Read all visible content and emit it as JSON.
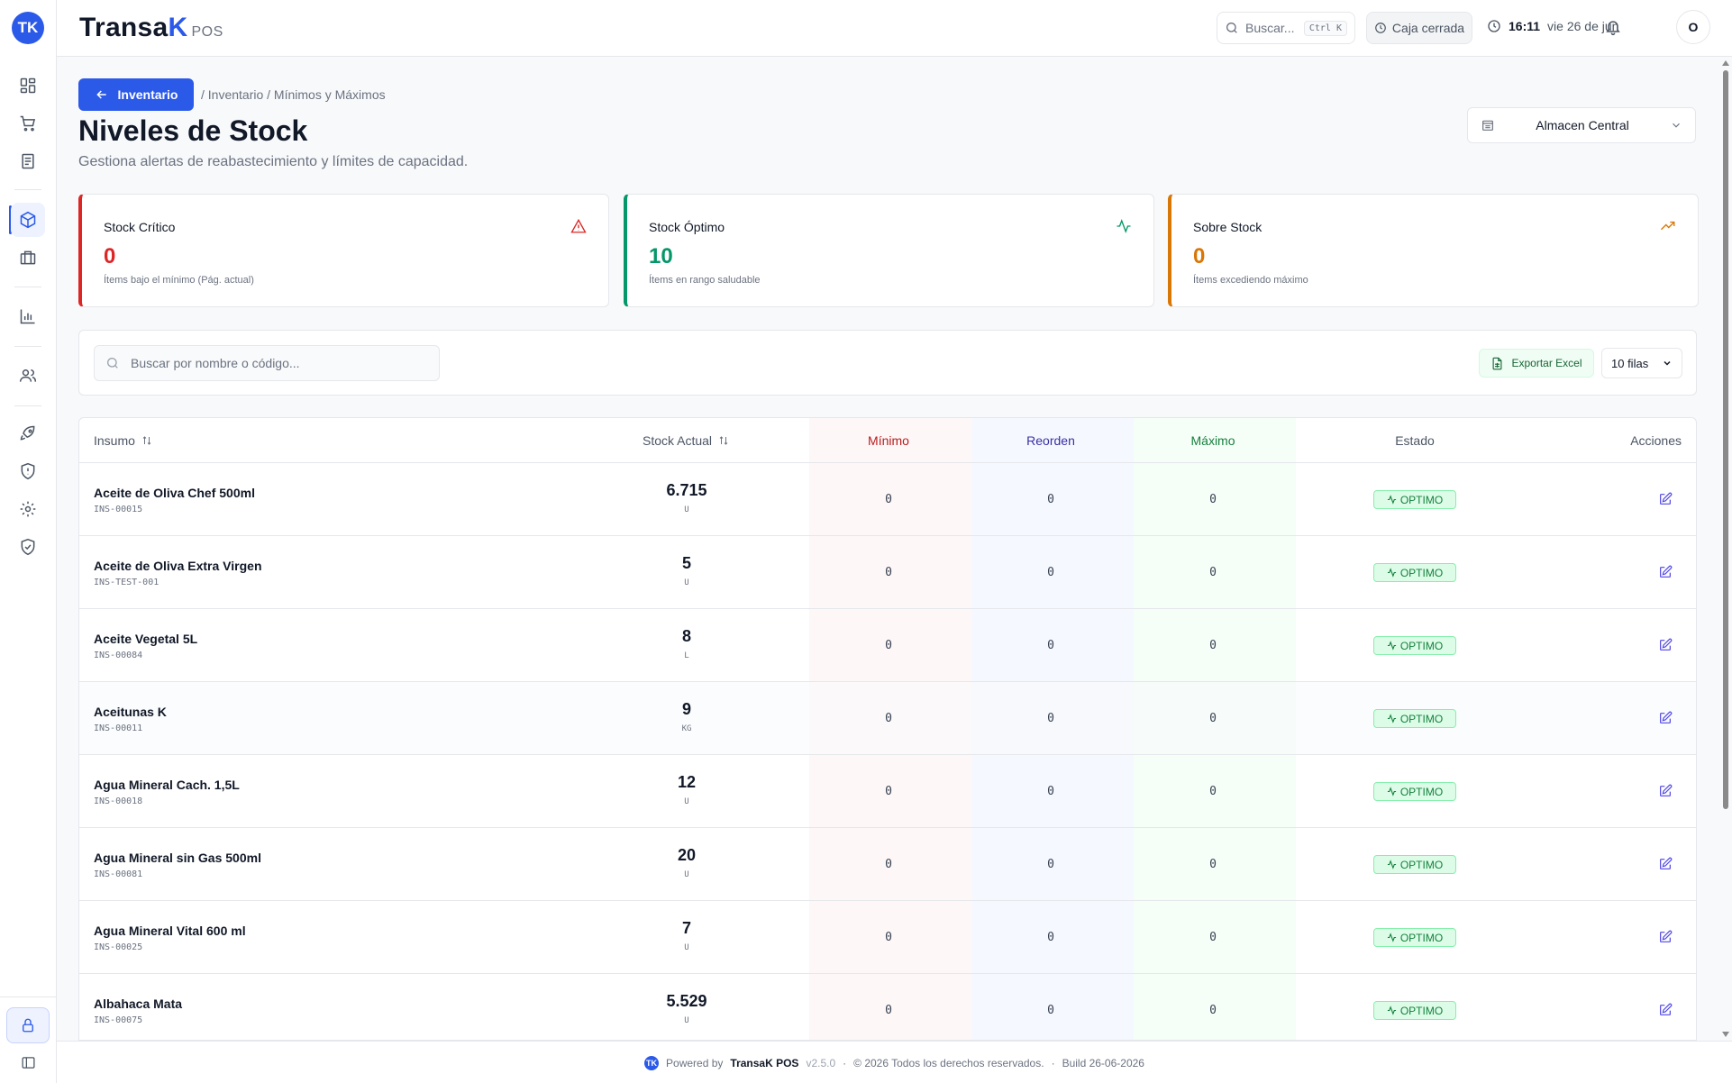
{
  "app": {
    "brand_main": "Transa",
    "brand_k": "K",
    "brand_pos": "POS",
    "logo_glyph": "TK"
  },
  "header": {
    "search_placeholder": "Buscar...",
    "search_shortcut": "Ctrl K",
    "cash_status": "Caja cerrada",
    "time": "16:11",
    "date": "vie 26 de jun",
    "avatar_initial": "O"
  },
  "page": {
    "back_label": "Inventario",
    "breadcrumb": "/ Inventario / Mínimos y Máximos",
    "title": "Niveles de Stock",
    "subtitle": "Gestiona alertas de reabastecimiento y límites de capacidad.",
    "warehouse": "Almacen Central"
  },
  "kpis": [
    {
      "label": "Stock Crítico",
      "value": "0",
      "desc": "Ítems bajo el mínimo (Pág. actual)",
      "color": "#dc2626",
      "icon": "warning-triangle-icon"
    },
    {
      "label": "Stock Óptimo",
      "value": "10",
      "desc": "Ítems en rango saludable",
      "color": "#059669",
      "icon": "activity-icon"
    },
    {
      "label": "Sobre Stock",
      "value": "0",
      "desc": "Ítems excediendo máximo",
      "color": "#d97706",
      "icon": "trending-up-icon"
    }
  ],
  "toolbar": {
    "search_placeholder": "Buscar por nombre o código...",
    "export_label": "Exportar Excel",
    "rows_label": "10 filas"
  },
  "table": {
    "columns": {
      "insumo": "Insumo",
      "stock": "Stock Actual",
      "minimo": "Mínimo",
      "reorden": "Reorden",
      "maximo": "Máximo",
      "estado": "Estado",
      "acciones": "Acciones"
    },
    "rows": [
      {
        "name": "Aceite de Oliva Chef 500ml",
        "code": "INS-00015",
        "stock": "6.715",
        "unit": "U",
        "min": "0",
        "reorder": "0",
        "max": "0",
        "status": "OPTIMO"
      },
      {
        "name": "Aceite de Oliva Extra Virgen",
        "code": "INS-TEST-001",
        "stock": "5",
        "unit": "U",
        "min": "0",
        "reorder": "0",
        "max": "0",
        "status": "OPTIMO"
      },
      {
        "name": "Aceite Vegetal 5L",
        "code": "INS-00084",
        "stock": "8",
        "unit": "L",
        "min": "0",
        "reorder": "0",
        "max": "0",
        "status": "OPTIMO"
      },
      {
        "name": "Aceitunas K",
        "code": "INS-00011",
        "stock": "9",
        "unit": "KG",
        "min": "0",
        "reorder": "0",
        "max": "0",
        "status": "OPTIMO"
      },
      {
        "name": "Agua Mineral Cach. 1,5L",
        "code": "INS-00018",
        "stock": "12",
        "unit": "U",
        "min": "0",
        "reorder": "0",
        "max": "0",
        "status": "OPTIMO"
      },
      {
        "name": "Agua Mineral sin Gas 500ml",
        "code": "INS-00081",
        "stock": "20",
        "unit": "U",
        "min": "0",
        "reorder": "0",
        "max": "0",
        "status": "OPTIMO"
      },
      {
        "name": "Agua Mineral Vital 600 ml",
        "code": "INS-00025",
        "stock": "7",
        "unit": "U",
        "min": "0",
        "reorder": "0",
        "max": "0",
        "status": "OPTIMO"
      },
      {
        "name": "Albahaca Mata",
        "code": "INS-00075",
        "stock": "5.529",
        "unit": "U",
        "min": "0",
        "reorder": "0",
        "max": "0",
        "status": "OPTIMO"
      }
    ]
  },
  "footer": {
    "powered": "Powered by",
    "brand": "TransaK POS",
    "version": "v2.5.0",
    "sep": "·",
    "copyright": "© 2026 Todos los derechos reservados.",
    "build": "Build 26-06-2026"
  },
  "colors": {
    "primary": "#2b59e8",
    "ok_bg": "#dcfce7",
    "ok_text": "#15803d",
    "edit": "#4f46e5"
  }
}
